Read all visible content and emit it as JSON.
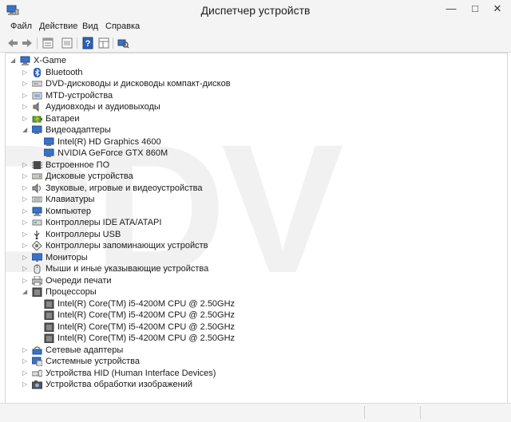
{
  "window": {
    "title": "Диспетчер устройств",
    "minimize_glyph": "—",
    "maximize_glyph": "□",
    "close_glyph": "✕"
  },
  "menu": [
    "Файл",
    "Действие",
    "Вид",
    "Справка"
  ],
  "toolbar": {
    "icons": [
      "back-arrow-icon",
      "forward-arrow-icon",
      "properties-icon",
      "show-hide-icon",
      "help-icon",
      "device-view-icon",
      "scan-hardware-icon"
    ]
  },
  "tree": {
    "root": "X-Game",
    "items": [
      {
        "label": "Bluetooth",
        "expanded": false,
        "icon": "bluetooth-icon"
      },
      {
        "label": "DVD-дисководы и дисководы компакт-дисков",
        "expanded": false,
        "icon": "dvd-drive-icon"
      },
      {
        "label": "MTD-устройства",
        "expanded": false,
        "icon": "mtd-device-icon"
      },
      {
        "label": "Аудиовходы и аудиовыходы",
        "expanded": false,
        "icon": "speaker-icon"
      },
      {
        "label": "Батареи",
        "expanded": false,
        "icon": "battery-icon"
      },
      {
        "label": "Видеоадаптеры",
        "expanded": true,
        "icon": "display-adapter-icon",
        "children": [
          "Intel(R) HD Graphics 4600",
          "NVIDIA GeForce GTX 860M"
        ]
      },
      {
        "label": "Встроенное ПО",
        "expanded": false,
        "icon": "firmware-icon"
      },
      {
        "label": "Дисковые устройства",
        "expanded": false,
        "icon": "disk-drive-icon"
      },
      {
        "label": "Звуковые, игровые и видеоустройства",
        "expanded": false,
        "icon": "sound-icon"
      },
      {
        "label": "Клавиатуры",
        "expanded": false,
        "icon": "keyboard-icon"
      },
      {
        "label": "Компьютер",
        "expanded": false,
        "icon": "computer-icon"
      },
      {
        "label": "Контроллеры IDE ATA/ATAPI",
        "expanded": false,
        "icon": "ide-controller-icon"
      },
      {
        "label": "Контроллеры USB",
        "expanded": false,
        "icon": "usb-controller-icon"
      },
      {
        "label": "Контроллеры запоминающих устройств",
        "expanded": false,
        "icon": "storage-controller-icon"
      },
      {
        "label": "Мониторы",
        "expanded": false,
        "icon": "monitor-icon"
      },
      {
        "label": "Мыши и иные указывающие устройства",
        "expanded": false,
        "icon": "mouse-icon"
      },
      {
        "label": "Очереди печати",
        "expanded": false,
        "icon": "printer-icon"
      },
      {
        "label": "Процессоры",
        "expanded": true,
        "icon": "processor-icon",
        "children": [
          "Intel(R) Core(TM) i5-4200M CPU @ 2.50GHz",
          "Intel(R) Core(TM) i5-4200M CPU @ 2.50GHz",
          "Intel(R) Core(TM) i5-4200M CPU @ 2.50GHz",
          "Intel(R) Core(TM) i5-4200M CPU @ 2.50GHz"
        ]
      },
      {
        "label": "Сетевые адаптеры",
        "expanded": false,
        "icon": "network-adapter-icon"
      },
      {
        "label": "Системные устройства",
        "expanded": false,
        "icon": "system-devices-icon"
      },
      {
        "label": "Устройства HID (Human Interface Devices)",
        "expanded": false,
        "icon": "hid-icon"
      },
      {
        "label": "Устройства обработки изображений",
        "expanded": false,
        "icon": "imaging-device-icon"
      }
    ]
  },
  "watermark": "DDV",
  "colors": {
    "background": "#ffffff",
    "chrome": "#f4f4f4",
    "border": "#d6d6d6",
    "icon_blue": "#2b62b8"
  }
}
